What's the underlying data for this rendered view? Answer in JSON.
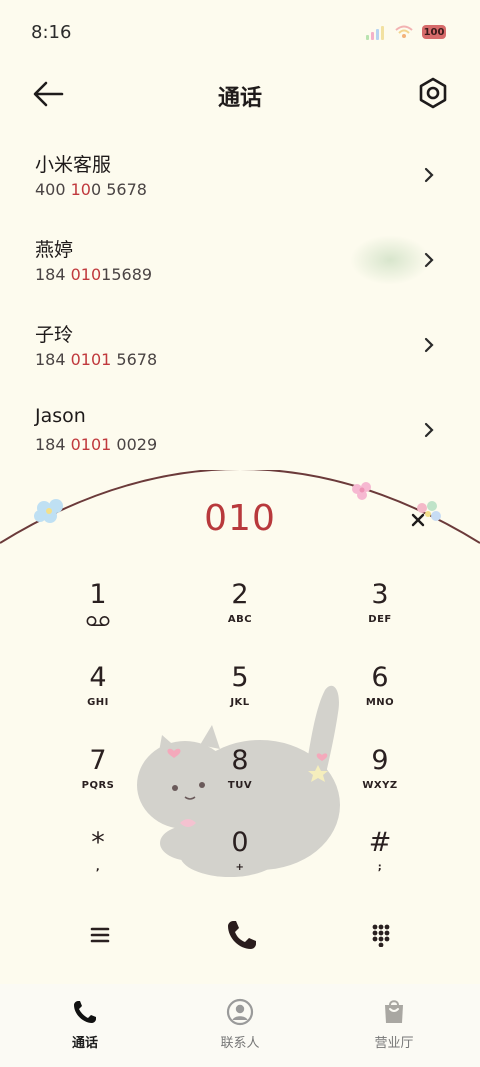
{
  "status_bar": {
    "time": "8:16",
    "battery": "100"
  },
  "header": {
    "title": "通话"
  },
  "contacts": [
    {
      "name": "小米客服",
      "number_parts": [
        "400 ",
        "10",
        "0 5678"
      ]
    },
    {
      "name": "燕婷",
      "number_parts": [
        "184 ",
        "010",
        "15689"
      ]
    },
    {
      "name": "子玲",
      "number_parts": [
        "184 ",
        "0101",
        " 5678"
      ]
    },
    {
      "name": "Jason",
      "number_parts": [
        "184 ",
        "0101",
        " 0029"
      ]
    }
  ],
  "dialer": {
    "input": "010"
  },
  "keypad": [
    {
      "digit": "1",
      "letters": ""
    },
    {
      "digit": "2",
      "letters": "ABC"
    },
    {
      "digit": "3",
      "letters": "DEF"
    },
    {
      "digit": "4",
      "letters": "GHI"
    },
    {
      "digit": "5",
      "letters": "JKL"
    },
    {
      "digit": "6",
      "letters": "MNO"
    },
    {
      "digit": "7",
      "letters": "PQRS"
    },
    {
      "digit": "8",
      "letters": "TUV"
    },
    {
      "digit": "9",
      "letters": "WXYZ"
    },
    {
      "digit": "*",
      "letters": ","
    },
    {
      "digit": "0",
      "letters": "+"
    },
    {
      "digit": "#",
      "letters": ";"
    }
  ],
  "bottom_nav": [
    {
      "label": "通话",
      "icon": "phone-icon",
      "active": true
    },
    {
      "label": "联系人",
      "icon": "contact-icon",
      "active": false
    },
    {
      "label": "营业厅",
      "icon": "bag-icon",
      "active": false
    }
  ],
  "colors": {
    "background": "#fdfbee",
    "accent": "#b8393c",
    "arc": "#6b3a3a"
  }
}
